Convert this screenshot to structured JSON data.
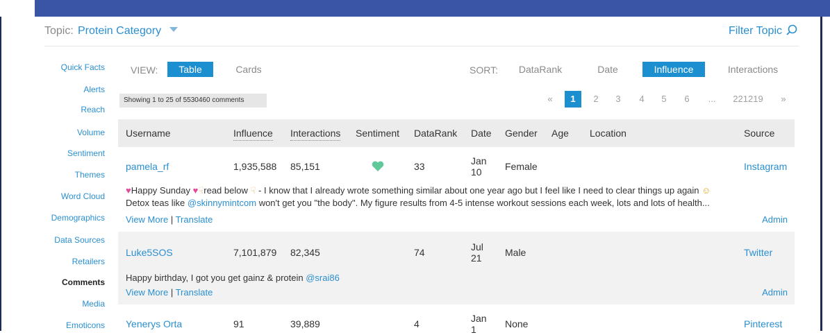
{
  "header": {
    "topic_label": "Topic:",
    "topic_value": "Protein Category",
    "filter_label": "Filter Topic"
  },
  "nav": {
    "items": [
      "Quick Facts",
      "Alerts",
      "Reach",
      "Volume",
      "Sentiment",
      "Themes",
      "Word Cloud",
      "Demographics",
      "Data Sources",
      "Retailers",
      "Comments",
      "Media",
      "Emoticons"
    ],
    "active": "Comments"
  },
  "view": {
    "label": "VIEW:",
    "table": "Table",
    "cards": "Cards"
  },
  "sort": {
    "label": "SORT:",
    "options": [
      "DataRank",
      "Date",
      "Influence",
      "Interactions"
    ],
    "selected": "Influence"
  },
  "showing": "Showing 1 to 25 of 5530460 comments",
  "pagination": {
    "prev": "«",
    "pages": [
      "1",
      "2",
      "3",
      "4",
      "5",
      "6"
    ],
    "ellipsis": "...",
    "last": "221219",
    "next": "»",
    "current": "1"
  },
  "table": {
    "columns": [
      "Username",
      "Influence",
      "Interactions",
      "Sentiment",
      "DataRank",
      "Date",
      "Gender",
      "Age",
      "Location",
      "Source"
    ],
    "rows": [
      {
        "username": "pamela_rf",
        "influence": "1,935,588",
        "interactions": "85,151",
        "sentiment": "heart-icon",
        "datarank": "33",
        "date_month": "Jan",
        "date_day": "10",
        "gender": "Female",
        "age": "",
        "location": "",
        "source": "Instagram",
        "comment_line1": "Happy Sunday",
        "comment_line1b": "read below",
        "comment_line1c": "- I know that I already wrote something similar about one year ago but I feel like I need to clear things up again",
        "comment_line2a": "Detox teas like",
        "comment_mention": "@skinnymintcom",
        "comment_line2b": "won't get you \"the body\". My figure results from 4-5 intense workout sessions each week, lots and lots of health...",
        "view_more": "View More",
        "translate": "Translate",
        "admin": "Admin"
      },
      {
        "username": "Luke5SOS",
        "influence": "7,101,879",
        "interactions": "82,345",
        "sentiment": "",
        "datarank": "74",
        "date_month": "Jul",
        "date_day": "21",
        "gender": "Male",
        "age": "",
        "location": "",
        "source": "Twitter",
        "comment_line1": "Happy birthday, I got you get gainz & protein",
        "comment_mention": "@srai86",
        "view_more": "View More",
        "translate": "Translate",
        "admin": "Admin"
      },
      {
        "username": "Yenerys Orta",
        "influence": "91",
        "interactions": "39,889",
        "sentiment": "",
        "datarank": "4",
        "date_month": "Jan",
        "date_day": "1",
        "gender": "None",
        "age": "",
        "location": "",
        "source": "Pinterest"
      }
    ]
  },
  "colors": {
    "accent": "#1b8fcf",
    "link": "#2a8fd0",
    "sentiment_positive": "#5fc99a",
    "topbar": "#3b55a6"
  }
}
